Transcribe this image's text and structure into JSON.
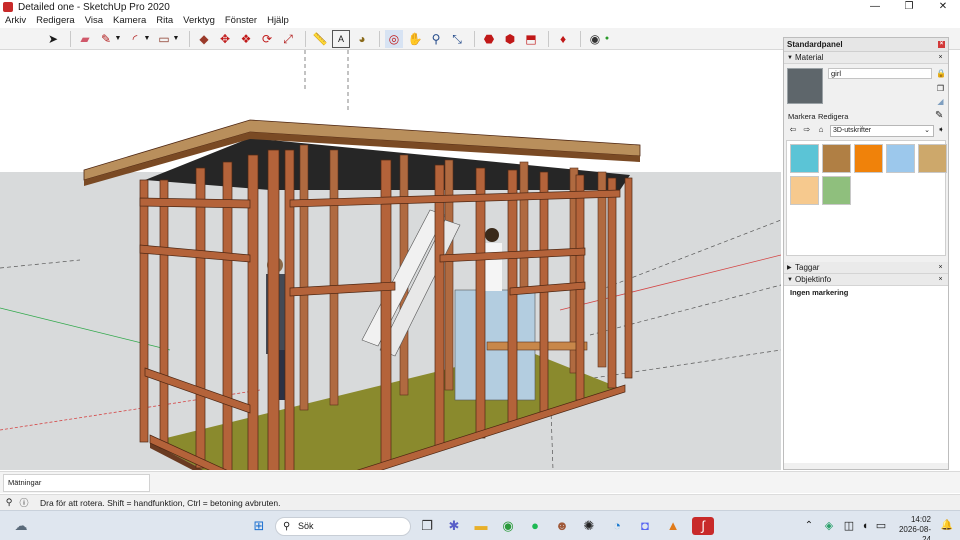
{
  "window": {
    "title": "Detailed one - SketchUp Pro 2020",
    "controls": [
      "—",
      "❐",
      "✕"
    ]
  },
  "menu": [
    "Arkiv",
    "Redigera",
    "Visa",
    "Kamera",
    "Rita",
    "Verktyg",
    "Fönster",
    "Hjälp"
  ],
  "toolbar": {
    "tools": [
      {
        "name": "select-tool",
        "glyph": "➤"
      },
      {
        "name": "eraser-tool",
        "glyph": "▰"
      },
      {
        "name": "line-tool",
        "glyph": "✎"
      },
      {
        "name": "arc-tool",
        "glyph": "◜"
      },
      {
        "name": "rectangle-tool",
        "glyph": "▭"
      },
      {
        "name": "push-pull-tool",
        "glyph": "◆"
      },
      {
        "name": "move-tool",
        "glyph": "✥"
      },
      {
        "name": "follow-me-tool",
        "glyph": "❖"
      },
      {
        "name": "rotate-tool",
        "glyph": "⟳"
      },
      {
        "name": "scale-tool",
        "glyph": "⤢"
      },
      {
        "name": "tape-measure-tool",
        "glyph": "📏"
      },
      {
        "name": "text-tool",
        "glyph": "A"
      },
      {
        "name": "paint-bucket-tool",
        "glyph": "◕"
      },
      {
        "name": "orbit-tool",
        "glyph": "◎"
      },
      {
        "name": "pan-tool",
        "glyph": "✋"
      },
      {
        "name": "zoom-tool",
        "glyph": "⚲"
      },
      {
        "name": "zoom-extents-tool",
        "glyph": "⤡"
      },
      {
        "name": "3d-warehouse-tool",
        "glyph": "⬣"
      },
      {
        "name": "extension-warehouse-tool",
        "glyph": "⬢"
      },
      {
        "name": "send-to-layout-tool",
        "glyph": "⬒"
      },
      {
        "name": "extension-manager-tool",
        "glyph": "♦"
      },
      {
        "name": "account-tool",
        "glyph": "◉"
      }
    ]
  },
  "tray": {
    "title": "Standardpanel",
    "material": {
      "section": "Material",
      "name": "girl",
      "tabs": [
        "Markera",
        "Redigera"
      ],
      "collection": "3D-utskrifter",
      "swatches": [
        {
          "color": "#5bc4d6"
        },
        {
          "color": "#b07f44"
        },
        {
          "color": "#f0820a"
        },
        {
          "color": "#9cc8ec"
        },
        {
          "color": "#cda86b"
        },
        {
          "color": "#f6c98e"
        },
        {
          "color": "#8fbf7d"
        }
      ]
    },
    "tags": {
      "section": "Taggar"
    },
    "entity_info": {
      "section": "Objektinfo",
      "selection": "Ingen markering"
    }
  },
  "measurements": {
    "label": "Mätningar"
  },
  "status": {
    "text": "Dra för att rotera. Shift = handfunktion, Ctrl = betoning avbruten."
  },
  "taskbar": {
    "search_placeholder": "Sök",
    "time": "14:02",
    "date": "2026-08-24"
  },
  "colors": {
    "wood": "#b4633a",
    "sky": "#ffffff",
    "ground": "#d7d9da",
    "floor": "#8a8a2c"
  }
}
